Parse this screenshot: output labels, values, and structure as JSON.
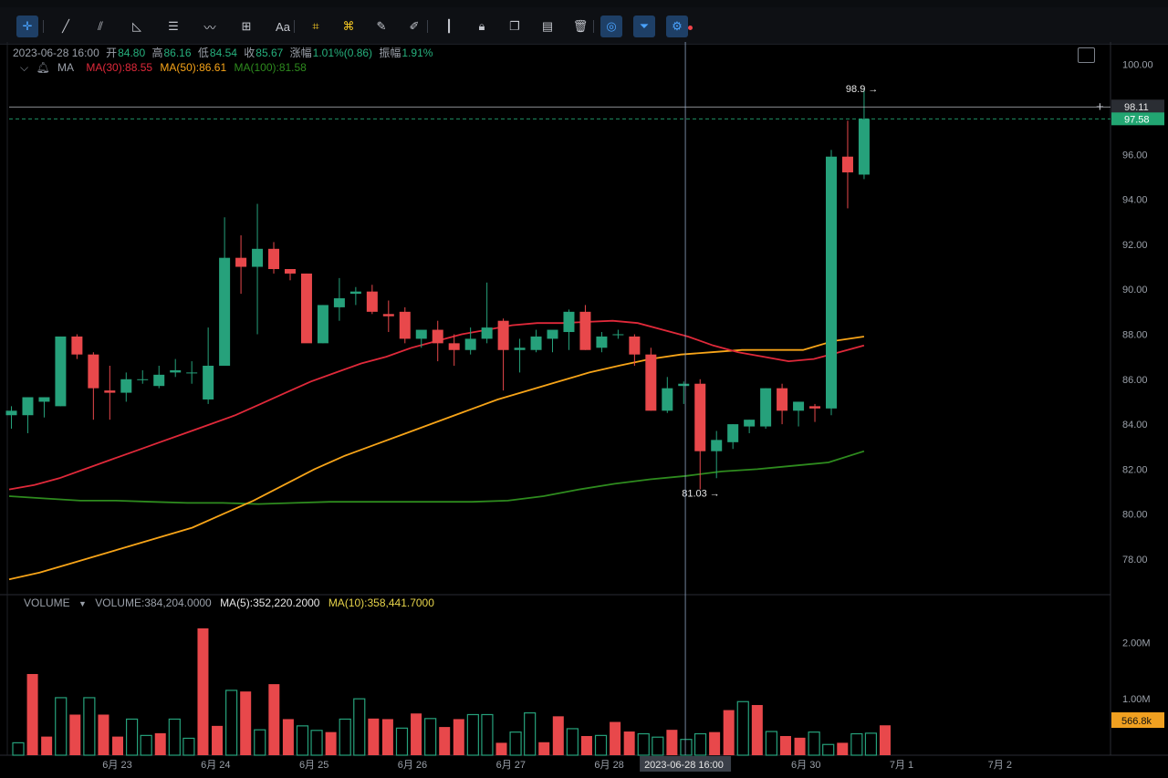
{
  "toolbar": {
    "tools": [
      "crosshair-icon",
      "trend-line-icon",
      "parallel-line-icon",
      "angle-icon",
      "horizontal-lines-icon",
      "wave-icon",
      "measure-icon",
      "text-icon",
      "fib-icon",
      "pattern-icon",
      "brush-icon",
      "pen-icon",
      "candle-tool-icon",
      "lock-icon",
      "copy-icon",
      "template-icon",
      "trash-icon",
      "magnet-icon",
      "filter-icon",
      "settings-icon"
    ],
    "text_tool_label": "Aa"
  },
  "header": {
    "datetime": "2023-06-28 16:00",
    "open_label": "开",
    "open": "84.80",
    "high_label": "高",
    "high": "86.16",
    "low_label": "低",
    "low": "84.54",
    "close_label": "收",
    "close": "85.67",
    "change_label": "涨幅",
    "change": "1.01%(0.86)",
    "amplitude_label": "振幅",
    "amplitude": "1.91%"
  },
  "ma_legend": {
    "label": "MA",
    "ma30": "MA(30):88.55",
    "ma50": "MA(50):86.61",
    "ma100": "MA(100):81.58"
  },
  "volume_legend": {
    "label": "VOLUME",
    "value": "VOLUME:384,204.0000",
    "ma5": "MA(5):352,220.2000",
    "ma10": "MA(10):358,441.7000"
  },
  "colors": {
    "up": "#26a17b",
    "down": "#e8484b",
    "ma30": "#e0293a",
    "ma50": "#f7a418",
    "ma100": "#2e8b1e",
    "vol_ma5": "#e6e6e6",
    "vol_ma10": "#e6d34a",
    "price_tag": "#22a672",
    "vol_tag": "#f0a020"
  },
  "chart_data": {
    "type": "candlestick",
    "price_axis": {
      "ylim": [
        76.5,
        101.0
      ],
      "ticks": [
        "100.00",
        "98.00",
        "96.00",
        "94.00",
        "92.00",
        "90.00",
        "88.00",
        "86.00",
        "84.00",
        "82.00",
        "80.00",
        "78.00"
      ]
    },
    "volume_axis": {
      "ylim": [
        0,
        2.75
      ],
      "ticks": [
        "2.00M",
        "1.00M"
      ],
      "unit": "M"
    },
    "x_labels": [
      "6月 23",
      "6月 24",
      "6月 25",
      "6月 26",
      "6月 27",
      "6月 28",
      "6月 30",
      "7月 1",
      "7月 2"
    ],
    "x_label_index": [
      6.5,
      12.5,
      18.5,
      24.5,
      30.5,
      36.5,
      48.5,
      54.5,
      60.5
    ],
    "crosshair": {
      "index": 41.1,
      "label": "2023-06-28 16:00"
    },
    "high_marker": {
      "index": 53,
      "label": "98.9"
    },
    "low_marker": {
      "index": 43,
      "label": "81.03"
    },
    "horizontal_line": {
      "value": 98.11,
      "label": "98.11"
    },
    "last_price": {
      "value": 97.58,
      "label": "97.58"
    },
    "last_volume": {
      "label": "566.8k"
    },
    "ohlc": [
      [
        84.4,
        84.8,
        83.8,
        84.6
      ],
      [
        84.4,
        85.2,
        83.6,
        85.2
      ],
      [
        85.0,
        85.2,
        84.3,
        85.2
      ],
      [
        84.8,
        87.9,
        84.8,
        87.9
      ],
      [
        87.9,
        88.0,
        86.9,
        87.1
      ],
      [
        87.1,
        87.2,
        84.2,
        85.6
      ],
      [
        85.5,
        86.6,
        84.2,
        85.4
      ],
      [
        85.4,
        86.3,
        85.0,
        86.0
      ],
      [
        86.0,
        86.4,
        85.8,
        86.0
      ],
      [
        85.7,
        86.6,
        85.6,
        86.2
      ],
      [
        86.3,
        86.9,
        86.1,
        86.4
      ],
      [
        86.3,
        86.8,
        85.8,
        86.3
      ],
      [
        85.1,
        88.3,
        84.9,
        86.6
      ],
      [
        86.6,
        93.2,
        86.6,
        91.4
      ],
      [
        91.4,
        92.4,
        89.8,
        91.0
      ],
      [
        91.0,
        93.8,
        88.0,
        91.8
      ],
      [
        91.8,
        92.1,
        90.7,
        90.9
      ],
      [
        90.9,
        90.9,
        90.4,
        90.7
      ],
      [
        90.7,
        90.7,
        87.9,
        87.6
      ],
      [
        87.6,
        89.3,
        87.6,
        89.3
      ],
      [
        89.2,
        90.5,
        88.6,
        89.6
      ],
      [
        89.8,
        90.1,
        89.3,
        89.9
      ],
      [
        89.9,
        90.2,
        88.9,
        89.0
      ],
      [
        88.9,
        89.5,
        88.1,
        88.8
      ],
      [
        89.0,
        89.2,
        87.6,
        87.8
      ],
      [
        87.8,
        88.0,
        87.4,
        88.2
      ],
      [
        88.2,
        88.6,
        86.8,
        87.6
      ],
      [
        87.6,
        88.0,
        86.6,
        87.3
      ],
      [
        87.3,
        88.3,
        87.1,
        87.8
      ],
      [
        87.8,
        90.3,
        87.6,
        88.3
      ],
      [
        88.6,
        88.7,
        85.5,
        87.3
      ],
      [
        87.3,
        87.8,
        86.3,
        87.4
      ],
      [
        87.3,
        88.2,
        87.2,
        87.9
      ],
      [
        87.8,
        88.0,
        87.2,
        88.2
      ],
      [
        88.1,
        89.1,
        87.3,
        89.0
      ],
      [
        89.0,
        89.3,
        87.3,
        87.3
      ],
      [
        87.4,
        88.1,
        87.2,
        87.9
      ],
      [
        88.0,
        88.2,
        87.8,
        88.0
      ],
      [
        87.9,
        88.0,
        86.6,
        87.1
      ],
      [
        87.1,
        87.4,
        84.6,
        84.6
      ],
      [
        84.6,
        86.1,
        84.5,
        85.6
      ],
      [
        85.7,
        85.9,
        84.9,
        85.8
      ],
      [
        85.8,
        86.0,
        81.1,
        82.8
      ],
      [
        82.8,
        83.7,
        81.6,
        83.3
      ],
      [
        83.2,
        84.0,
        82.9,
        84.0
      ],
      [
        83.9,
        84.2,
        83.6,
        84.2
      ],
      [
        83.9,
        85.6,
        83.8,
        85.6
      ],
      [
        85.6,
        85.8,
        84.0,
        84.6
      ],
      [
        84.6,
        85.0,
        83.9,
        85.0
      ],
      [
        84.8,
        84.9,
        84.1,
        84.7
      ],
      [
        84.7,
        96.2,
        84.4,
        95.9
      ],
      [
        95.9,
        97.5,
        93.6,
        95.2
      ],
      [
        95.1,
        98.9,
        94.9,
        97.58
      ]
    ],
    "volume": [
      0.22,
      1.44,
      0.33,
      1.02,
      0.72,
      1.02,
      0.72,
      0.33,
      0.64,
      0.35,
      0.39,
      0.64,
      0.3,
      2.25,
      0.52,
      1.15,
      1.13,
      0.45,
      1.26,
      0.64,
      0.52,
      0.44,
      0.41,
      0.64,
      1.0,
      0.65,
      0.64,
      0.48,
      0.74,
      0.65,
      0.5,
      0.64,
      0.72,
      0.72,
      0.22,
      0.41,
      0.75,
      0.23,
      0.69,
      0.47,
      0.34,
      0.35,
      0.59,
      0.42,
      0.38,
      0.32,
      0.45,
      0.28,
      0.38,
      0.41,
      0.8,
      0.95,
      0.89,
      0.42,
      0.34,
      0.31,
      0.41,
      0.19,
      0.22,
      0.38,
      0.39,
      0.53
    ],
    "ma30": [
      81.1,
      81.3,
      81.6,
      82.0,
      82.4,
      82.8,
      83.2,
      83.6,
      84.0,
      84.4,
      84.9,
      85.4,
      85.9,
      86.3,
      86.7,
      87.0,
      87.4,
      87.7,
      88.0,
      88.2,
      88.4,
      88.5,
      88.5,
      88.55,
      88.6,
      88.5,
      88.2,
      87.9,
      87.5,
      87.2,
      87.0,
      86.8,
      86.9,
      87.2,
      87.5
    ],
    "ma50": [
      77.1,
      77.4,
      77.8,
      78.2,
      78.6,
      79.0,
      79.4,
      80.0,
      80.6,
      81.3,
      82.0,
      82.6,
      83.1,
      83.6,
      84.1,
      84.6,
      85.1,
      85.5,
      85.9,
      86.3,
      86.61,
      86.9,
      87.1,
      87.2,
      87.3,
      87.3,
      87.3,
      87.7,
      87.9
    ],
    "ma100": [
      80.8,
      80.7,
      80.6,
      80.6,
      80.55,
      80.5,
      80.5,
      80.45,
      80.5,
      80.55,
      80.55,
      80.55,
      80.55,
      80.55,
      80.6,
      80.8,
      81.1,
      81.35,
      81.55,
      81.7,
      81.9,
      82.0,
      82.15,
      82.3,
      82.8
    ]
  }
}
